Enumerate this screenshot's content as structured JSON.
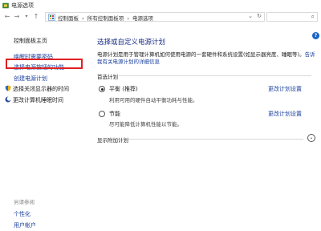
{
  "window": {
    "title": "电源选项"
  },
  "address": {
    "crumbs": [
      "控制面板",
      "›",
      "所有控制面板项",
      "›",
      "电源选项"
    ],
    "back_glyph": "←",
    "forward_glyph": "→",
    "up_glyph": "↑",
    "dropdown_glyph": "⌄",
    "refresh_glyph": "↻",
    "search_glyph": "⌕"
  },
  "help": {
    "glyph": "?"
  },
  "sidebar": {
    "home": "控制面板主页",
    "link1": "唤醒时需要密码",
    "link2": "选择电源按钮的功能",
    "link3": "创建电源计划",
    "link4": "选择关闭显示器的时间",
    "link5": "更改计算机睡眠时间",
    "see_also": "另请参阅",
    "personalize": "个性化",
    "user_accounts": "用户帐户"
  },
  "main": {
    "heading": "选择或自定义电源计划",
    "description": "电源计划是用于管理计算机如何使用电源的一套硬件和系统设置(如显示器亮度、睡眠等)。",
    "desc_link": "告诉我有关电源计划的详细信息",
    "preferred_label": "首选计划",
    "plans": [
      {
        "name": "平衡 (推荐)",
        "desc": "利用可用的硬件自动平衡功耗与性能。",
        "change": "更改计划设置",
        "selected": true
      },
      {
        "name": "节能",
        "desc": "尽可能降低计算机性能以节能。",
        "change": "更改计划设置",
        "selected": false
      }
    ],
    "more_label": "显示附加计划",
    "expand_glyph": "⌄"
  },
  "colors": {
    "link": "#1a3f9e",
    "heading": "#1e3287",
    "highlight": "#e02020"
  }
}
